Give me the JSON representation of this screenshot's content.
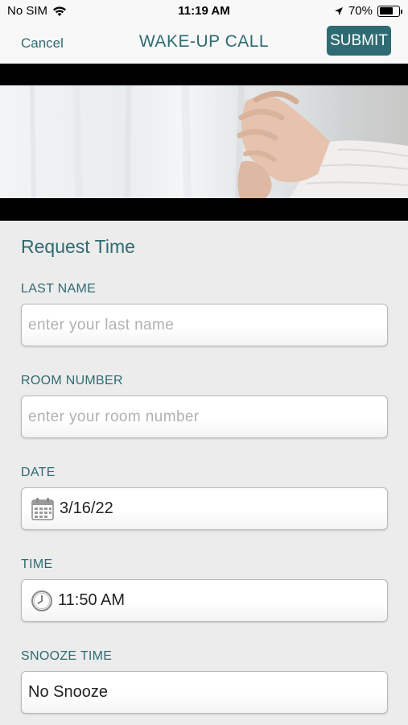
{
  "status_bar": {
    "carrier": "No SIM",
    "time": "11:19 AM",
    "battery_percent": "70%",
    "battery_level": 0.7
  },
  "nav": {
    "cancel_label": "Cancel",
    "title": "WAKE-UP CALL",
    "submit_label": "SUBMIT"
  },
  "form": {
    "section_title": "Request Time",
    "last_name": {
      "label": "LAST NAME",
      "placeholder": "enter your last name",
      "value": ""
    },
    "room_number": {
      "label": "ROOM NUMBER",
      "placeholder": "enter your room number",
      "value": ""
    },
    "date": {
      "label": "DATE",
      "value": "3/16/22",
      "icon": "calendar-icon"
    },
    "time": {
      "label": "TIME",
      "value": "11:50 AM",
      "icon": "clock-icon"
    },
    "snooze": {
      "label": "SNOOZE TIME",
      "value": "No Snooze"
    }
  },
  "colors": {
    "accent": "#2f6b72",
    "background": "#ececec",
    "nav_background": "#f8f8f8"
  }
}
